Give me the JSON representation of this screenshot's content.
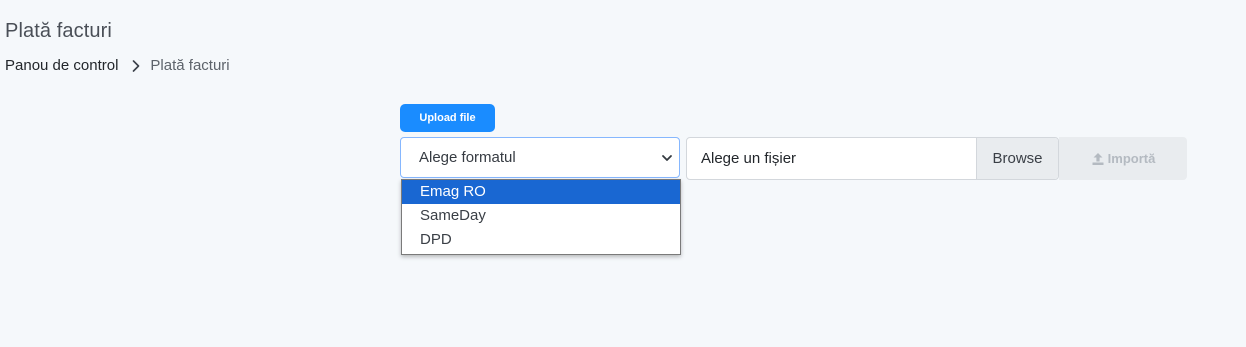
{
  "page": {
    "title": "Plată facturi"
  },
  "breadcrumb": {
    "home": "Panou de control",
    "current": "Plată facturi"
  },
  "upload": {
    "button_label": "Upload file"
  },
  "format_select": {
    "placeholder": "Alege formatul",
    "options": [
      "Emag RO",
      "SameDay",
      "DPD"
    ],
    "highlighted_option": "Emag RO"
  },
  "file_input": {
    "label": "Alege un fișier",
    "browse_label": "Browse"
  },
  "import": {
    "label": "Importă",
    "icon": "upload-icon"
  },
  "colors": {
    "primary": "#1a8cff",
    "option_highlight": "#1967d2",
    "background": "#f5f8fb"
  }
}
